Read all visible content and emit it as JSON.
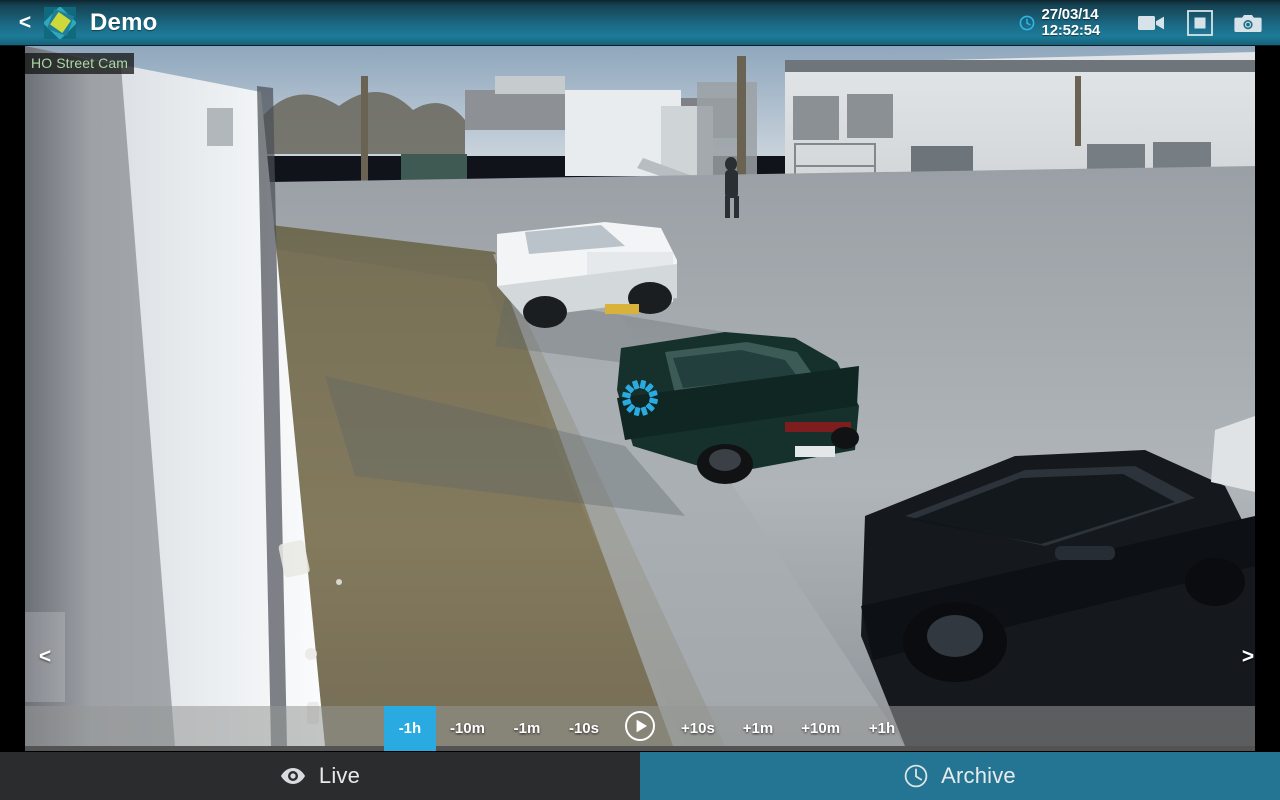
{
  "titlebar": {
    "back_label": "<",
    "app_title": "Demo",
    "logo_icon": "app-logo-diamond",
    "clock_icon": "clock-icon",
    "datetime": "27/03/14\n12:52:54",
    "date": "27/03/14",
    "time": "12:52:54",
    "buttons": [
      {
        "name": "record-video-button",
        "icon": "video-camera-icon"
      },
      {
        "name": "stop-button",
        "icon": "stop-square-icon"
      },
      {
        "name": "snapshot-button",
        "icon": "photo-camera-icon"
      }
    ]
  },
  "video": {
    "camera_label": "HO Street Cam",
    "prev_camera_label": "<",
    "next_camera_label": ">",
    "spinner_icon": "loading-spinner-icon",
    "spinner_color": "#29abe2",
    "is_loading": true
  },
  "seekbar": {
    "back_steps": [
      {
        "label": "-1h",
        "active": true
      },
      {
        "label": "-10m",
        "active": false
      },
      {
        "label": "-1m",
        "active": false
      },
      {
        "label": "-10s",
        "active": false
      }
    ],
    "play_icon": "play-circle-icon",
    "forward_steps": [
      {
        "label": "+10s",
        "active": false
      },
      {
        "label": "+1m",
        "active": false
      },
      {
        "label": "+10m",
        "active": false
      },
      {
        "label": "+1h",
        "active": false
      }
    ],
    "active_color": "#29abe2"
  },
  "tabs": [
    {
      "name": "tab-live",
      "label": "Live",
      "icon": "eye-icon",
      "selected": false,
      "color": "#2a2c2e"
    },
    {
      "name": "tab-archive",
      "label": "Archive",
      "icon": "clock-icon",
      "selected": true,
      "color": "#237593"
    }
  ]
}
